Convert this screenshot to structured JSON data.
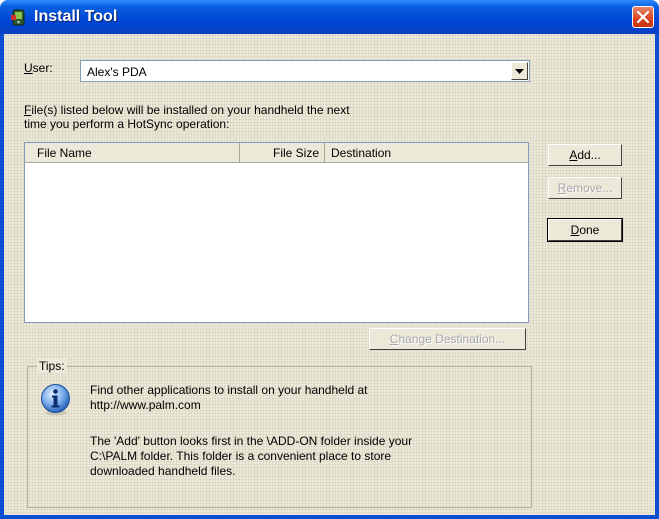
{
  "window": {
    "title": "Install Tool"
  },
  "user": {
    "label_prefix": "",
    "label_hotkey": "U",
    "label_rest": "ser:",
    "selected": "Alex's PDA"
  },
  "description": {
    "line1_hotkey": "F",
    "line1_rest": "ile(s) listed below will be installed on your handheld the next",
    "line2": "time you perform a HotSync operation:"
  },
  "file_list": {
    "columns": [
      "File Name",
      "File Size",
      "Destination"
    ],
    "rows": []
  },
  "buttons": {
    "add": {
      "hotkey": "A",
      "rest": "dd..."
    },
    "remove": {
      "hotkey": "R",
      "rest": "emove..."
    },
    "done": {
      "hotkey": "D",
      "rest": "one"
    },
    "change_destination": {
      "hotkey": "C",
      "rest": "hange Destination..."
    }
  },
  "tips": {
    "legend": "Tips:",
    "tip1_line1": "Find other applications to install on your handheld at",
    "tip1_line2": "http://www.palm.com",
    "tip2_line1": "The 'Add' button looks first in the \\ADD-ON folder inside your",
    "tip2_line2": "C:\\PALM folder. This folder is a convenient place to store",
    "tip2_line3": "downloaded handheld files."
  },
  "icons": {
    "app": "install-tool-icon",
    "close": "close-icon",
    "dropdown": "chevron-down-icon",
    "info": "info-icon"
  },
  "colors": {
    "titlebar": "#0046d6",
    "client_bg": "#ece9d8",
    "close": "#d9431b",
    "disabled_text": "#a7a6aa"
  }
}
